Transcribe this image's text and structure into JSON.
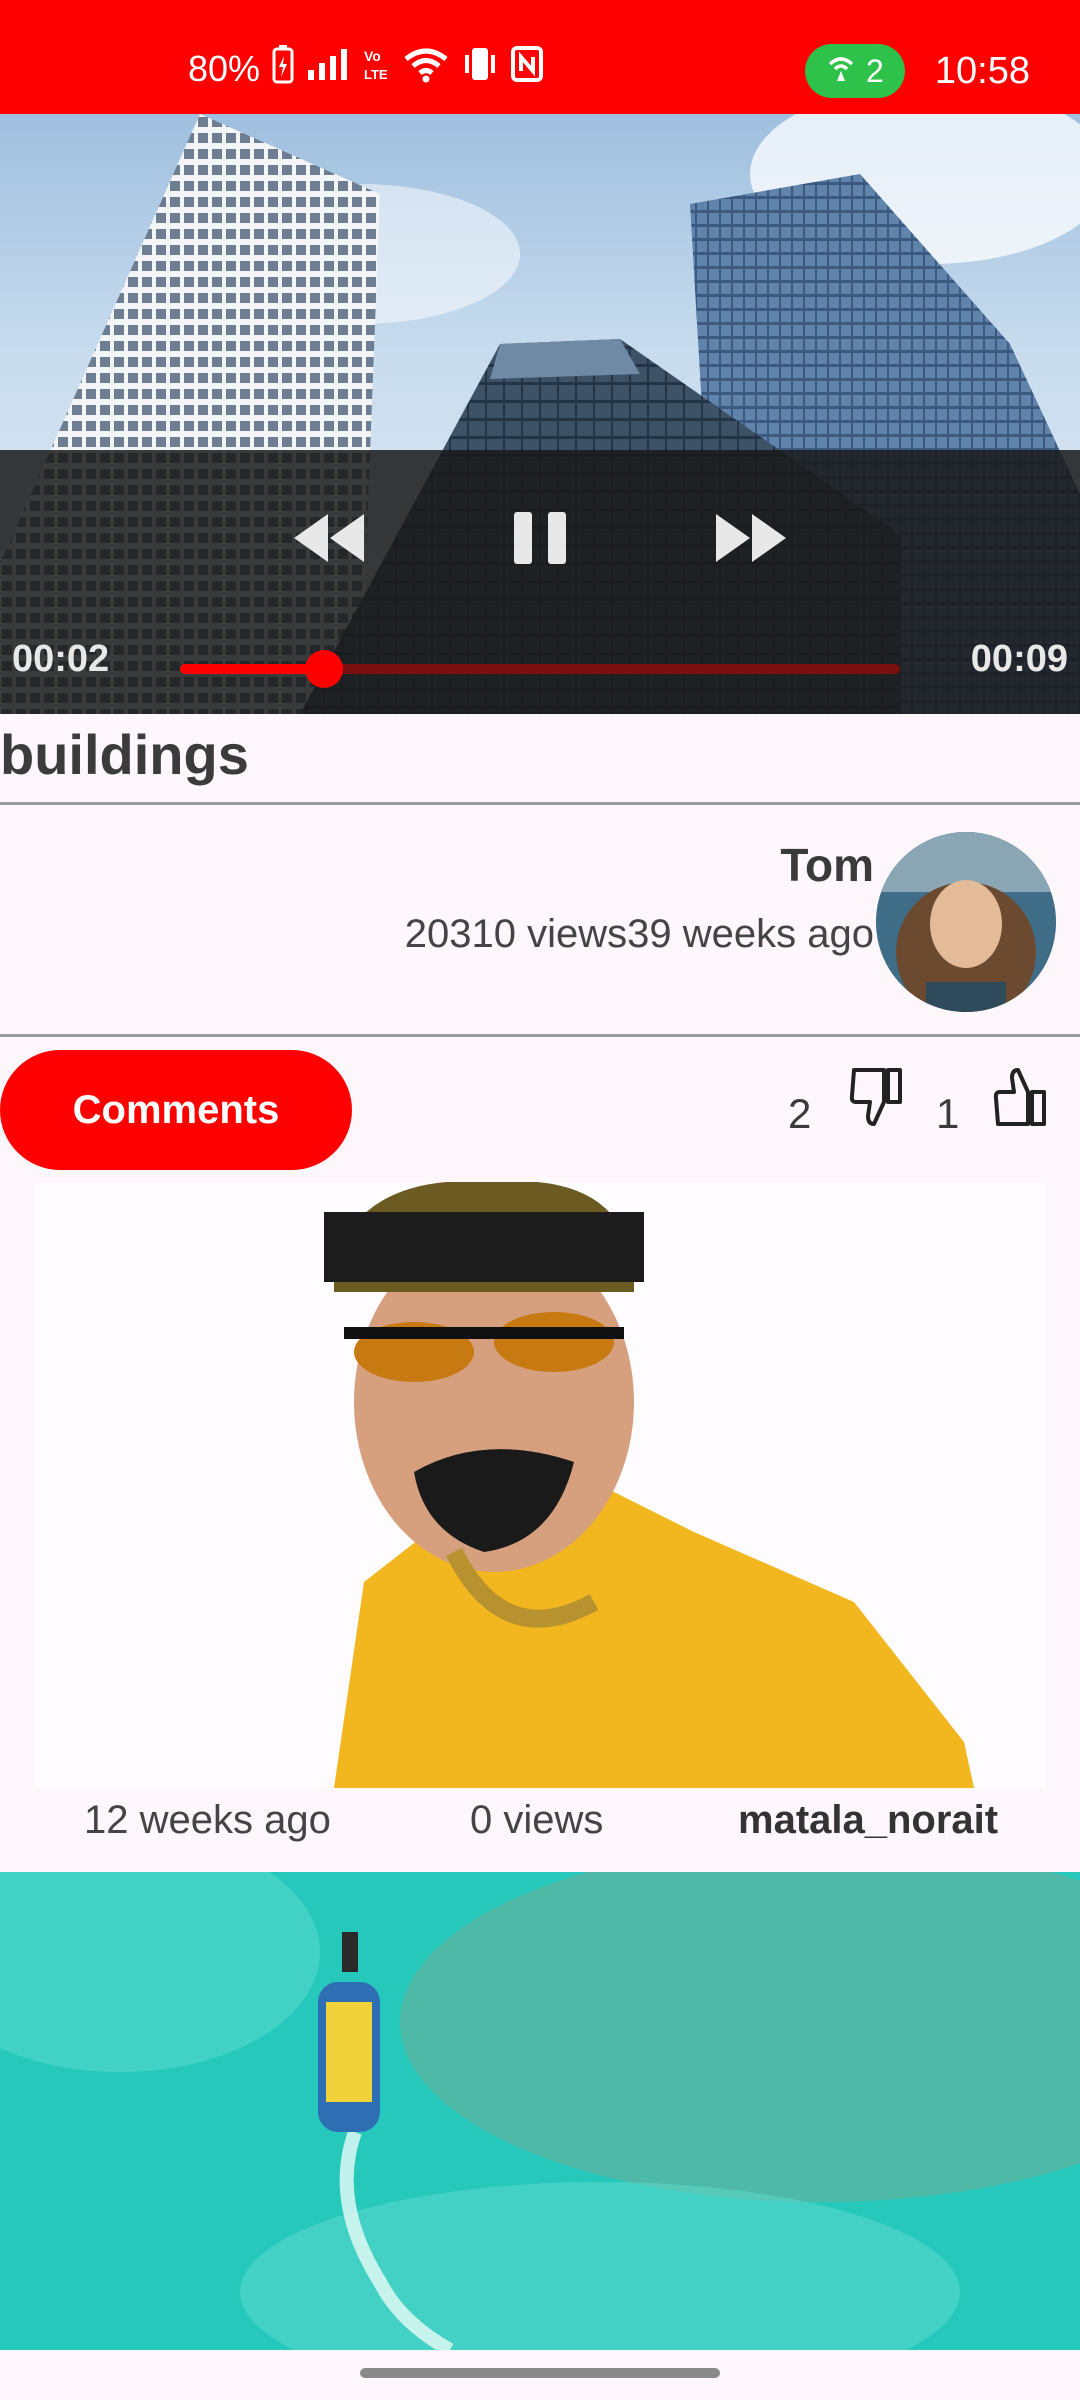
{
  "status_bar": {
    "battery": "80%",
    "hotspot_count": "2",
    "time": "10:58"
  },
  "player": {
    "elapsed": "00:02",
    "duration": "00:09",
    "progress_fraction": 0.2
  },
  "video": {
    "title": "buildings",
    "author": "Tom",
    "meta": "20310 views39 weeks ago"
  },
  "actions": {
    "comments_label": "Comments",
    "dislikes": "2",
    "likes": "1"
  },
  "related": [
    {
      "age": "12 weeks ago",
      "views": "0 views",
      "author": "matala_norait"
    }
  ],
  "colors": {
    "accent": "#ff0000",
    "hotspot": "#2fc24a",
    "background": "#fdf7fc"
  },
  "icons": [
    "battery-icon",
    "signal-icon",
    "volte-icon",
    "wifi-icon",
    "vibrate-icon",
    "nfc-icon",
    "hotspot-icon",
    "rewind-icon",
    "pause-icon",
    "fast-forward-icon",
    "dislike-icon",
    "like-icon"
  ]
}
